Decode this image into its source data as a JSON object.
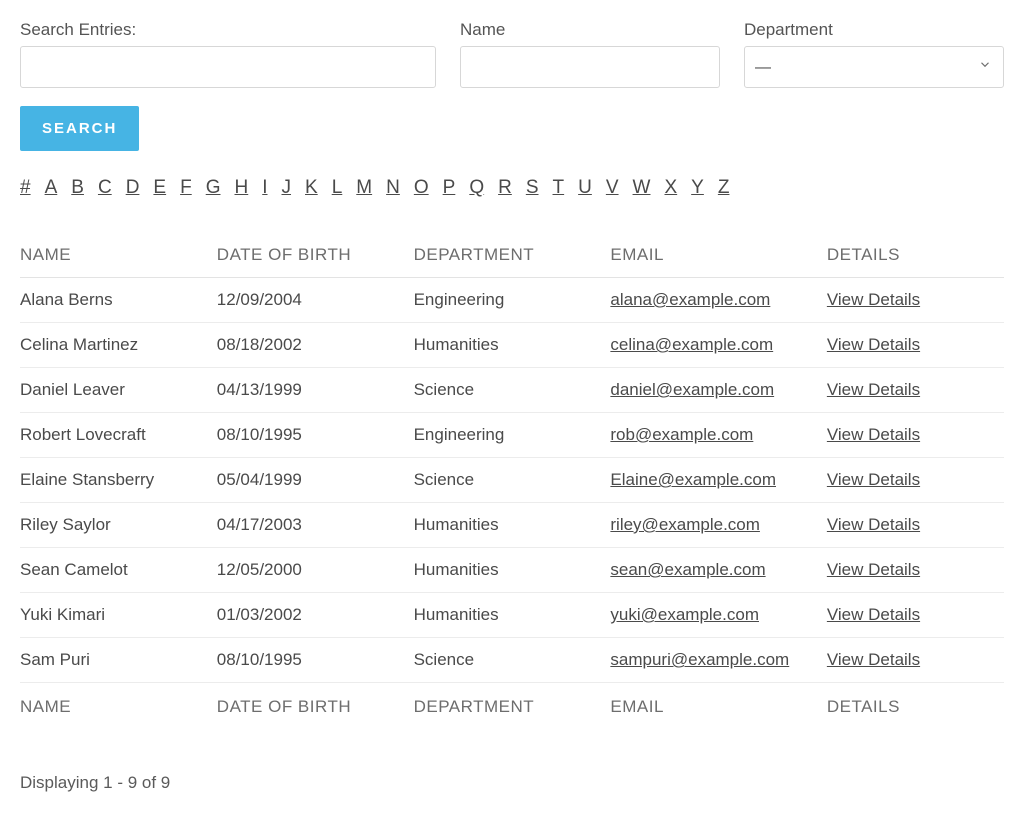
{
  "filters": {
    "search_label": "Search Entries:",
    "search_value": "",
    "name_label": "Name",
    "name_value": "",
    "department_label": "Department",
    "department_selected": "—"
  },
  "buttons": {
    "search": "SEARCH"
  },
  "alpha_nav": [
    "#",
    "A",
    "B",
    "C",
    "D",
    "E",
    "F",
    "G",
    "H",
    "I",
    "J",
    "K",
    "L",
    "M",
    "N",
    "O",
    "P",
    "Q",
    "R",
    "S",
    "T",
    "U",
    "V",
    "W",
    "X",
    "Y",
    "Z"
  ],
  "columns": {
    "name": "NAME",
    "dob": "DATE OF BIRTH",
    "department": "DEPARTMENT",
    "email": "EMAIL",
    "details": "DETAILS"
  },
  "view_details_label": "View Details",
  "rows": [
    {
      "name": "Alana Berns",
      "dob": "12/09/2004",
      "department": "Engineering",
      "email": "alana@example.com"
    },
    {
      "name": "Celina Martinez",
      "dob": "08/18/2002",
      "department": "Humanities",
      "email": "celina@example.com"
    },
    {
      "name": "Daniel Leaver",
      "dob": "04/13/1999",
      "department": "Science",
      "email": "daniel@example.com"
    },
    {
      "name": "Robert Lovecraft",
      "dob": "08/10/1995",
      "department": "Engineering",
      "email": "rob@example.com"
    },
    {
      "name": "Elaine Stansberry",
      "dob": "05/04/1999",
      "department": "Science",
      "email": "Elaine@example.com"
    },
    {
      "name": "Riley Saylor",
      "dob": "04/17/2003",
      "department": "Humanities",
      "email": "riley@example.com"
    },
    {
      "name": "Sean Camelot",
      "dob": "12/05/2000",
      "department": "Humanities",
      "email": "sean@example.com"
    },
    {
      "name": "Yuki Kimari",
      "dob": "01/03/2002",
      "department": "Humanities",
      "email": "yuki@example.com"
    },
    {
      "name": "Sam Puri",
      "dob": "08/10/1995",
      "department": "Science",
      "email": "sampuri@example.com"
    }
  ],
  "summary": "Displaying 1 - 9 of 9"
}
